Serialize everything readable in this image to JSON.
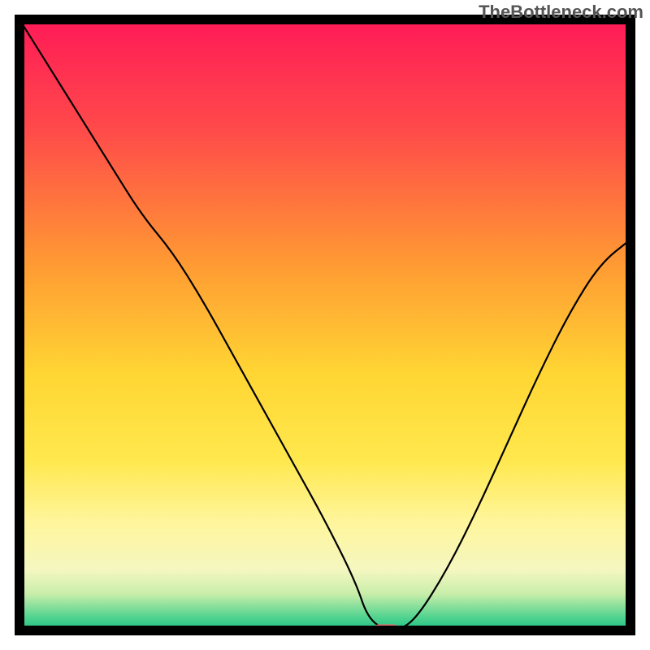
{
  "watermark": "TheBottleneck.com",
  "chart_data": {
    "type": "line",
    "title": "",
    "xlabel": "",
    "ylabel": "",
    "xlim": [
      0,
      100
    ],
    "ylim": [
      0,
      100
    ],
    "x": [
      0,
      5,
      10,
      15,
      20,
      25,
      30,
      35,
      40,
      45,
      50,
      55,
      57,
      60,
      62,
      65,
      70,
      75,
      80,
      85,
      90,
      95,
      100
    ],
    "values": [
      100,
      92,
      84,
      76,
      68,
      62,
      54,
      45,
      36,
      27,
      18,
      8,
      2,
      0,
      0,
      2,
      10,
      20,
      31,
      42,
      52,
      60,
      64
    ],
    "background_gradient": {
      "stops": [
        {
          "offset": 0.0,
          "color": "#ff1a57"
        },
        {
          "offset": 0.18,
          "color": "#ff4a4a"
        },
        {
          "offset": 0.4,
          "color": "#ff9a33"
        },
        {
          "offset": 0.58,
          "color": "#ffd633"
        },
        {
          "offset": 0.72,
          "color": "#ffe84d"
        },
        {
          "offset": 0.82,
          "color": "#fff59a"
        },
        {
          "offset": 0.9,
          "color": "#f5f7c0"
        },
        {
          "offset": 0.94,
          "color": "#c9eeaa"
        },
        {
          "offset": 0.98,
          "color": "#4cd28e"
        },
        {
          "offset": 1.0,
          "color": "#1fbf85"
        }
      ]
    },
    "marker": {
      "x": 60,
      "y": 0,
      "color": "#d86f6f",
      "width": 4,
      "height": 1.5
    },
    "border_color": "#000000"
  }
}
